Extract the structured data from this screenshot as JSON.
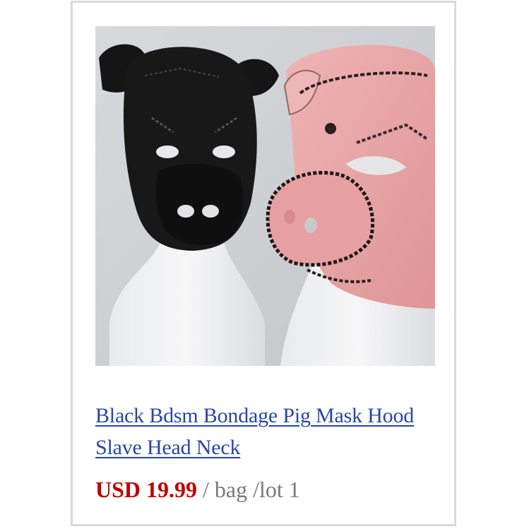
{
  "product": {
    "title": "Black Bdsm Bondage Pig Mask Hood Slave Head Neck",
    "price": "USD 19.99",
    "unit": " / bag /lot 1",
    "image_alt": "black and pink pig mask hoods on mannequin heads"
  },
  "colors": {
    "link": "#2646a8",
    "price": "#c00000",
    "unit": "#7a7a7a",
    "border": "#d9d9d9",
    "mask_black": "#141414",
    "mask_pink": "#e9a6a8"
  }
}
